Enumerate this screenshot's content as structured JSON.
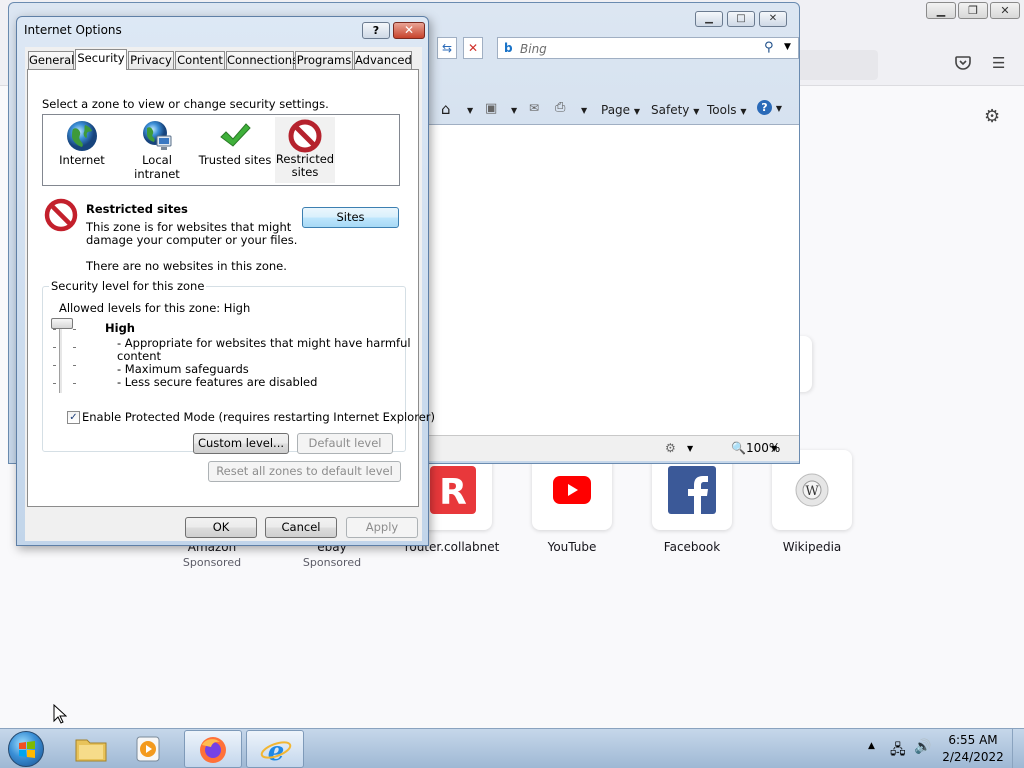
{
  "firefox": {
    "tiles": [
      {
        "label": "Amazon",
        "sub": "Sponsored"
      },
      {
        "label": "ebay",
        "sub": "Sponsored"
      },
      {
        "label": "router.collabnet",
        "sub": ""
      },
      {
        "label": "YouTube",
        "sub": ""
      },
      {
        "label": "Facebook",
        "sub": ""
      },
      {
        "label": "Wikipedia",
        "sub": ""
      }
    ]
  },
  "ie": {
    "search_placeholder": "Bing",
    "commands": {
      "page": "Page",
      "safety": "Safety",
      "tools": "Tools"
    },
    "zoom": "100%"
  },
  "dialog": {
    "title": "Internet Options",
    "tabs": [
      "General",
      "Security",
      "Privacy",
      "Content",
      "Connections",
      "Programs",
      "Advanced"
    ],
    "active_tab": "Security",
    "select_zone_prompt": "Select a zone to view or change security settings.",
    "zones": [
      {
        "label": "Internet",
        "icon": "globe-icon"
      },
      {
        "label": "Local intranet",
        "icon": "intranet-icon"
      },
      {
        "label": "Trusted sites",
        "icon": "checkmark-icon"
      },
      {
        "label_line1": "Restricted",
        "label_line2": "sites",
        "icon": "restricted-icon",
        "selected": true
      }
    ],
    "zone_info": {
      "heading": "Restricted sites",
      "desc_line1": "This zone is for websites that might",
      "desc_line2": "damage your computer or your files.",
      "note": "There are no websites in this zone.",
      "sites_button": "Sites"
    },
    "security_level": {
      "group_label": "Security level for this zone",
      "allowed": "Allowed levels for this zone: High",
      "level_name": "High",
      "bullets": [
        "- Appropriate for websites that might have harmful",
        "content",
        "- Maximum safeguards",
        "- Less secure features are disabled"
      ],
      "protected_mode_label": "Enable Protected Mode (requires restarting Internet Explorer)",
      "protected_mode_checked": true,
      "custom_level_button": "Custom level...",
      "default_level_button": "Default level"
    },
    "reset_all_button": "Reset all zones to default level",
    "ok_button": "OK",
    "cancel_button": "Cancel",
    "apply_button": "Apply"
  },
  "taskbar": {
    "time": "6:55 AM",
    "date": "2/24/2022"
  }
}
